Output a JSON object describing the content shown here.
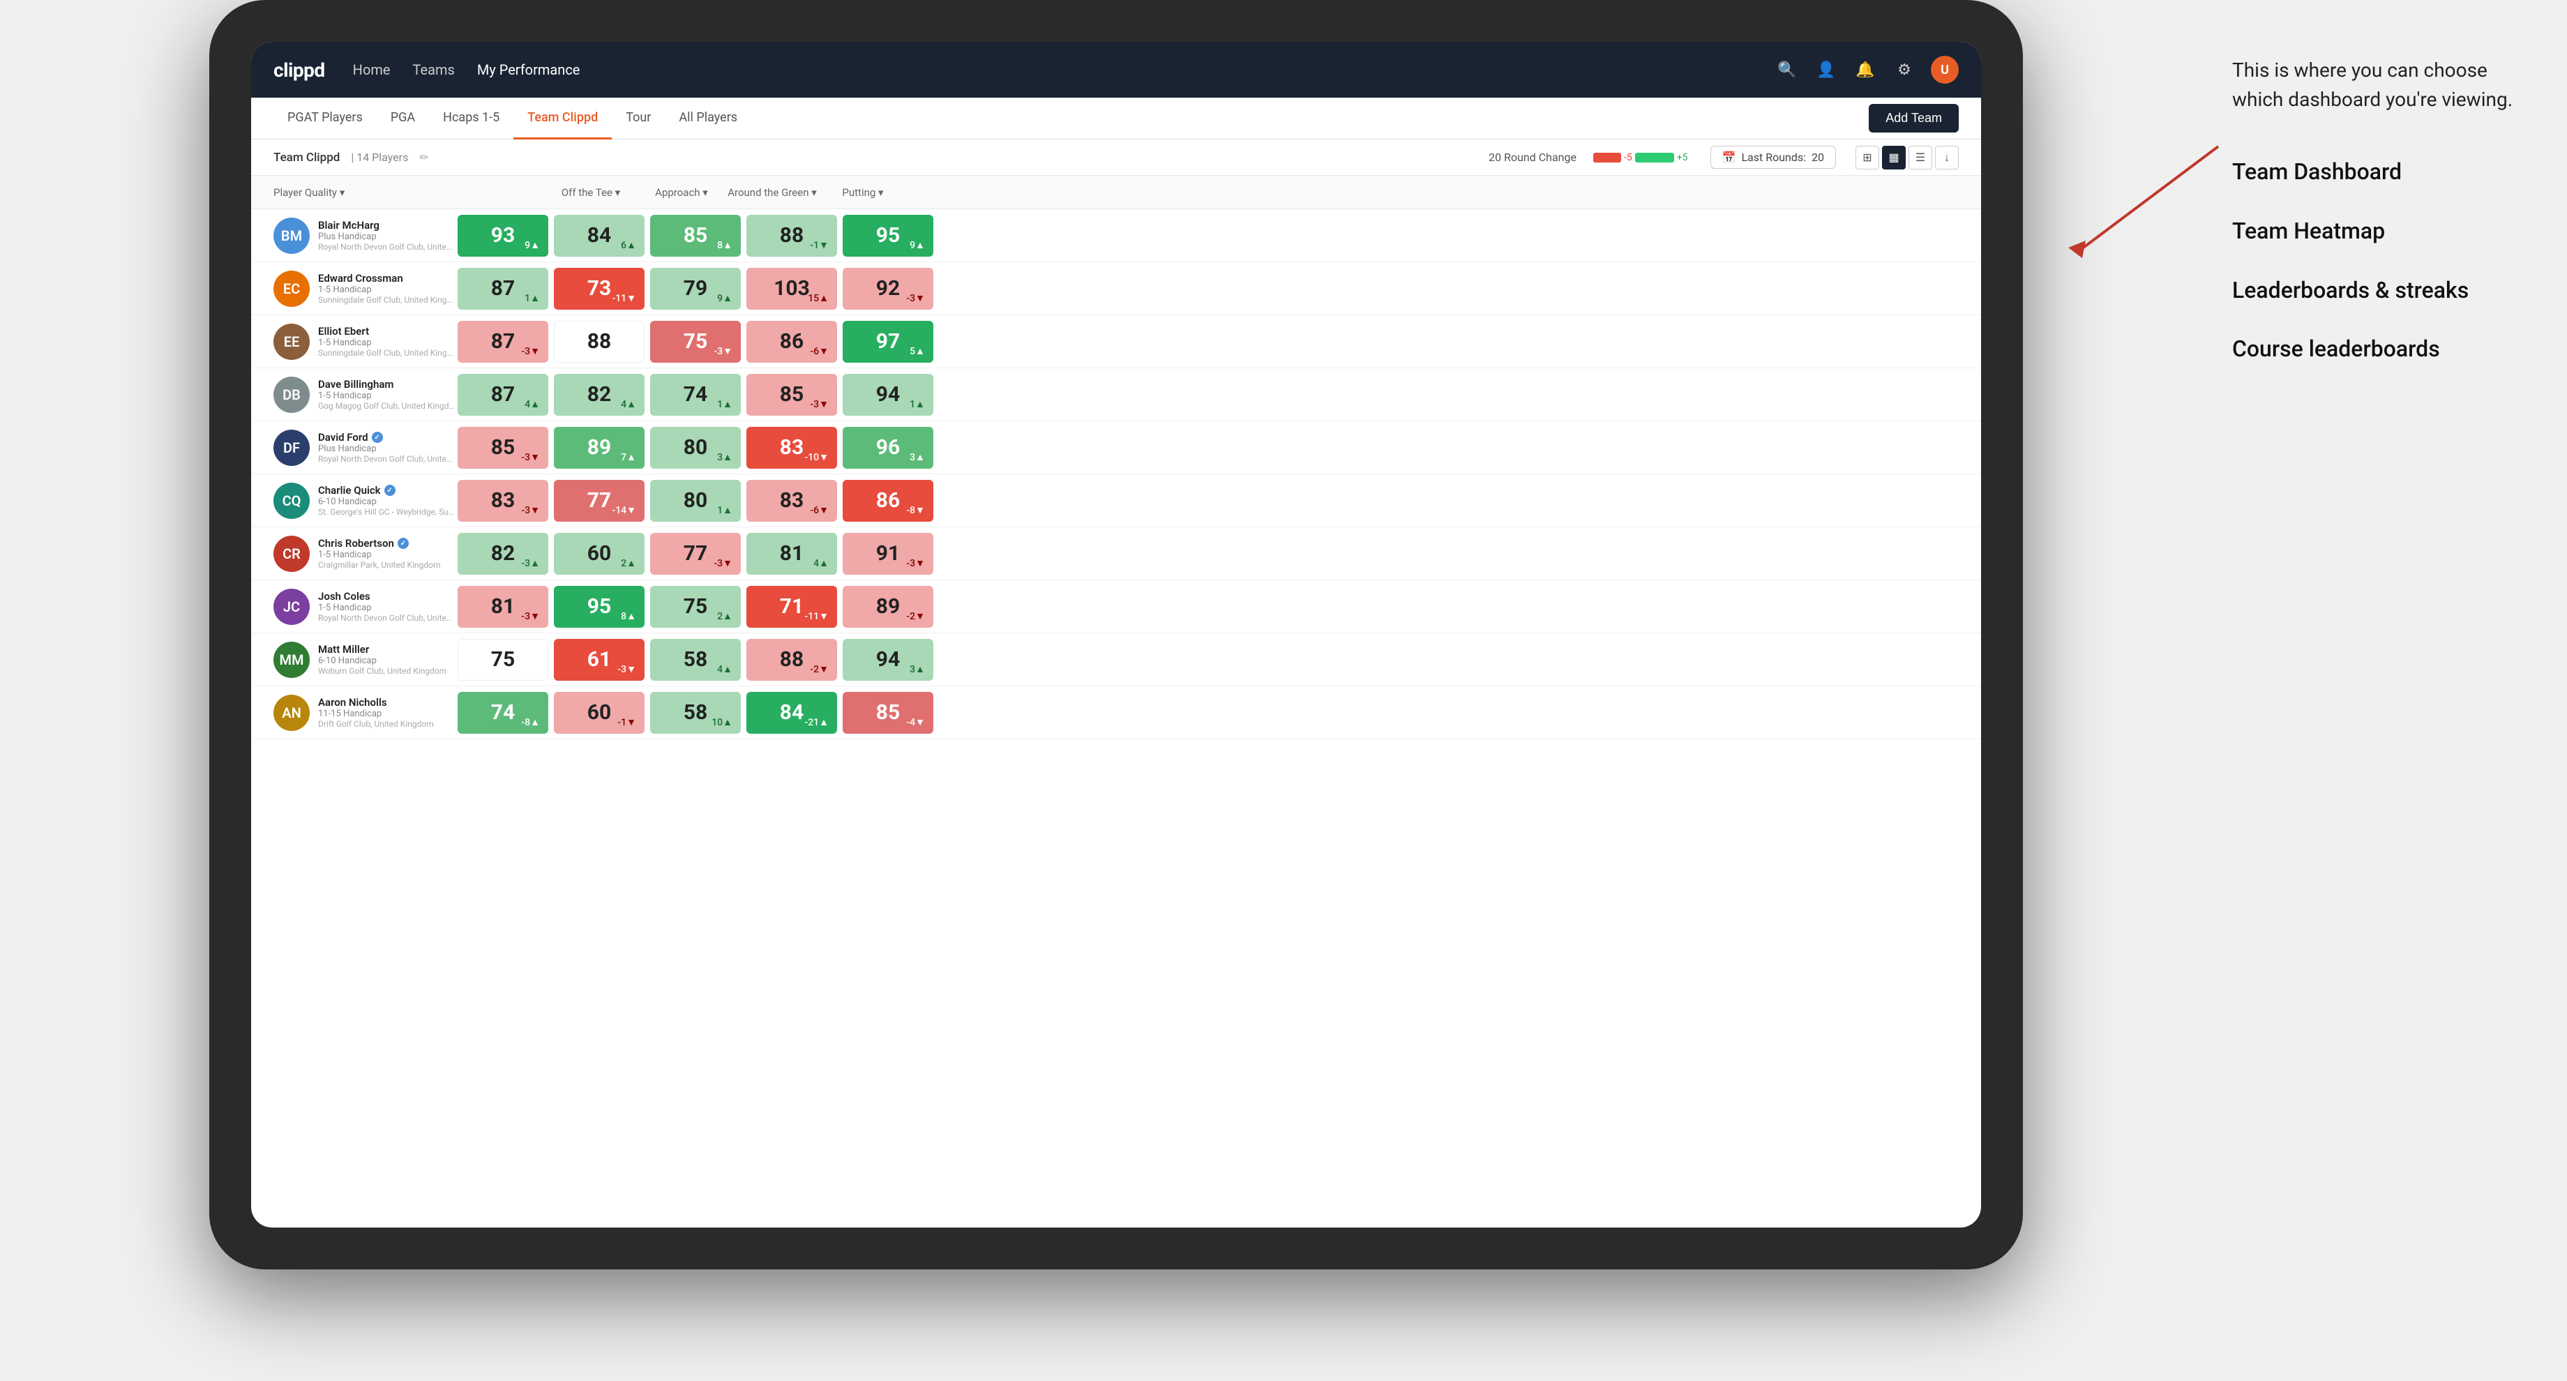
{
  "annotation": {
    "callout": "This is where you can choose which dashboard you're viewing.",
    "items": [
      "Team Dashboard",
      "Team Heatmap",
      "Leaderboards & streaks",
      "Course leaderboards"
    ]
  },
  "navbar": {
    "logo": "clippd",
    "nav_items": [
      "Home",
      "Teams",
      "My Performance"
    ],
    "active_nav": "My Performance"
  },
  "sub_tabs": {
    "tabs": [
      "PGAT Players",
      "PGA",
      "Hcaps 1-5",
      "Team Clippd",
      "Tour",
      "All Players"
    ],
    "active_tab": "Team Clippd",
    "add_team_label": "Add Team"
  },
  "team_bar": {
    "team_name": "Team Clippd",
    "separator": "|",
    "player_count": "14 Players",
    "round_change_label": "20 Round Change",
    "change_neg": "-5",
    "change_pos": "+5",
    "last_rounds_label": "Last Rounds:",
    "last_rounds_value": "20"
  },
  "table": {
    "headers": {
      "player": "Player Quality",
      "tee": "Off the Tee",
      "approach": "Approach",
      "atg": "Around the Green",
      "putting": "Putting"
    },
    "players": [
      {
        "name": "Blair McHarg",
        "handicap": "Plus Handicap",
        "club": "Royal North Devon Golf Club, United Kingdom",
        "avatar_initials": "BM",
        "avatar_class": "av-blue",
        "pq": {
          "value": "93",
          "change": "9▲",
          "dir": "up",
          "bg": "bg-green-strong"
        },
        "tee": {
          "value": "84",
          "change": "6▲",
          "dir": "up",
          "bg": "bg-green-light"
        },
        "approach": {
          "value": "85",
          "change": "8▲",
          "dir": "up",
          "bg": "bg-green-medium"
        },
        "atg": {
          "value": "88",
          "change": "-1▼",
          "dir": "down",
          "bg": "bg-green-light"
        },
        "putting": {
          "value": "95",
          "change": "9▲",
          "dir": "up",
          "bg": "bg-green-strong"
        }
      },
      {
        "name": "Edward Crossman",
        "handicap": "1-5 Handicap",
        "club": "Sunningdale Golf Club, United Kingdom",
        "avatar_initials": "EC",
        "avatar_class": "av-orange",
        "pq": {
          "value": "87",
          "change": "1▲",
          "dir": "up",
          "bg": "bg-green-light"
        },
        "tee": {
          "value": "73",
          "change": "-11▼",
          "dir": "down",
          "bg": "bg-red-strong"
        },
        "approach": {
          "value": "79",
          "change": "9▲",
          "dir": "up",
          "bg": "bg-green-light"
        },
        "atg": {
          "value": "103",
          "change": "15▲",
          "dir": "up",
          "bg": "bg-red-light"
        },
        "putting": {
          "value": "92",
          "change": "-3▼",
          "dir": "down",
          "bg": "bg-red-light"
        }
      },
      {
        "name": "Elliot Ebert",
        "handicap": "1-5 Handicap",
        "club": "Sunningdale Golf Club, United Kingdom",
        "avatar_initials": "EE",
        "avatar_class": "av-brown",
        "pq": {
          "value": "87",
          "change": "-3▼",
          "dir": "down",
          "bg": "bg-red-light"
        },
        "tee": {
          "value": "88",
          "change": "",
          "dir": "",
          "bg": "bg-white"
        },
        "approach": {
          "value": "75",
          "change": "-3▼",
          "dir": "down",
          "bg": "bg-red-medium"
        },
        "atg": {
          "value": "86",
          "change": "-6▼",
          "dir": "down",
          "bg": "bg-red-light"
        },
        "putting": {
          "value": "97",
          "change": "5▲",
          "dir": "up",
          "bg": "bg-green-strong"
        }
      },
      {
        "name": "Dave Billingham",
        "handicap": "1-5 Handicap",
        "club": "Gog Magog Golf Club, United Kingdom",
        "avatar_initials": "DB",
        "avatar_class": "av-gray",
        "pq": {
          "value": "87",
          "change": "4▲",
          "dir": "up",
          "bg": "bg-green-light"
        },
        "tee": {
          "value": "82",
          "change": "4▲",
          "dir": "up",
          "bg": "bg-green-light"
        },
        "approach": {
          "value": "74",
          "change": "1▲",
          "dir": "up",
          "bg": "bg-green-light"
        },
        "atg": {
          "value": "85",
          "change": "-3▼",
          "dir": "down",
          "bg": "bg-red-light"
        },
        "putting": {
          "value": "94",
          "change": "1▲",
          "dir": "up",
          "bg": "bg-green-light"
        }
      },
      {
        "name": "David Ford",
        "handicap": "Plus Handicap",
        "club": "Royal North Devon Golf Club, United Kingdom",
        "avatar_initials": "DF",
        "avatar_class": "av-darkblue",
        "verified": true,
        "pq": {
          "value": "85",
          "change": "-3▼",
          "dir": "down",
          "bg": "bg-red-light"
        },
        "tee": {
          "value": "89",
          "change": "7▲",
          "dir": "up",
          "bg": "bg-green-medium"
        },
        "approach": {
          "value": "80",
          "change": "3▲",
          "dir": "up",
          "bg": "bg-green-light"
        },
        "atg": {
          "value": "83",
          "change": "-10▼",
          "dir": "down",
          "bg": "bg-red-strong"
        },
        "putting": {
          "value": "96",
          "change": "3▲",
          "dir": "up",
          "bg": "bg-green-medium"
        }
      },
      {
        "name": "Charlie Quick",
        "handicap": "6-10 Handicap",
        "club": "St. George's Hill GC - Weybridge, Surrey, Uni...",
        "avatar_initials": "CQ",
        "avatar_class": "av-teal",
        "verified": true,
        "pq": {
          "value": "83",
          "change": "-3▼",
          "dir": "down",
          "bg": "bg-red-light"
        },
        "tee": {
          "value": "77",
          "change": "-14▼",
          "dir": "down",
          "bg": "bg-red-medium"
        },
        "approach": {
          "value": "80",
          "change": "1▲",
          "dir": "up",
          "bg": "bg-green-light"
        },
        "atg": {
          "value": "83",
          "change": "-6▼",
          "dir": "down",
          "bg": "bg-red-light"
        },
        "putting": {
          "value": "86",
          "change": "-8▼",
          "dir": "down",
          "bg": "bg-red-strong"
        }
      },
      {
        "name": "Chris Robertson",
        "handicap": "1-5 Handicap",
        "club": "Craigmillar Park, United Kingdom",
        "avatar_initials": "CR",
        "avatar_class": "av-red",
        "verified": true,
        "pq": {
          "value": "82",
          "change": "-3▲",
          "dir": "up",
          "bg": "bg-green-light"
        },
        "tee": {
          "value": "60",
          "change": "2▲",
          "dir": "up",
          "bg": "bg-green-light"
        },
        "approach": {
          "value": "77",
          "change": "-3▼",
          "dir": "down",
          "bg": "bg-red-light"
        },
        "atg": {
          "value": "81",
          "change": "4▲",
          "dir": "up",
          "bg": "bg-green-light"
        },
        "putting": {
          "value": "91",
          "change": "-3▼",
          "dir": "down",
          "bg": "bg-red-light"
        }
      },
      {
        "name": "Josh Coles",
        "handicap": "1-5 Handicap",
        "club": "Royal North Devon Golf Club, United Kingdom",
        "avatar_initials": "JC",
        "avatar_class": "av-purple",
        "pq": {
          "value": "81",
          "change": "-3▼",
          "dir": "down",
          "bg": "bg-red-light"
        },
        "tee": {
          "value": "95",
          "change": "8▲",
          "dir": "up",
          "bg": "bg-green-strong"
        },
        "approach": {
          "value": "75",
          "change": "2▲",
          "dir": "up",
          "bg": "bg-green-light"
        },
        "atg": {
          "value": "71",
          "change": "-11▼",
          "dir": "down",
          "bg": "bg-red-strong"
        },
        "putting": {
          "value": "89",
          "change": "-2▼",
          "dir": "down",
          "bg": "bg-red-light"
        }
      },
      {
        "name": "Matt Miller",
        "handicap": "6-10 Handicap",
        "club": "Woburn Golf Club, United Kingdom",
        "avatar_initials": "MM",
        "avatar_class": "av-green",
        "pq": {
          "value": "75",
          "change": "",
          "dir": "",
          "bg": "bg-white"
        },
        "tee": {
          "value": "61",
          "change": "-3▼",
          "dir": "down",
          "bg": "bg-red-strong"
        },
        "approach": {
          "value": "58",
          "change": "4▲",
          "dir": "up",
          "bg": "bg-green-light"
        },
        "atg": {
          "value": "88",
          "change": "-2▼",
          "dir": "down",
          "bg": "bg-red-light"
        },
        "putting": {
          "value": "94",
          "change": "3▲",
          "dir": "up",
          "bg": "bg-green-light"
        }
      },
      {
        "name": "Aaron Nicholls",
        "handicap": "11-15 Handicap",
        "club": "Drift Golf Club, United Kingdom",
        "avatar_initials": "AN",
        "avatar_class": "av-amber",
        "pq": {
          "value": "74",
          "change": "-8▲",
          "dir": "up",
          "bg": "bg-green-medium"
        },
        "tee": {
          "value": "60",
          "change": "-1▼",
          "dir": "down",
          "bg": "bg-red-light"
        },
        "approach": {
          "value": "58",
          "change": "10▲",
          "dir": "up",
          "bg": "bg-green-light"
        },
        "atg": {
          "value": "84",
          "change": "-21▲",
          "dir": "up",
          "bg": "bg-green-strong"
        },
        "putting": {
          "value": "85",
          "change": "-4▼",
          "dir": "down",
          "bg": "bg-red-medium"
        }
      }
    ]
  }
}
